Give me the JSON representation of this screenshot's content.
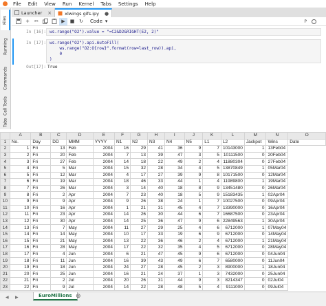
{
  "menubar": {
    "items": [
      "File",
      "Edit",
      "View",
      "Run",
      "Kernel",
      "Tabs",
      "Settings",
      "Help"
    ]
  },
  "sidebar": {
    "tabs": [
      "Files",
      "Running",
      "Commands",
      "Cell Tools",
      "Tabs"
    ]
  },
  "tabs": [
    {
      "label": "Launcher"
    },
    {
      "label": "xlwings gifs.ipy"
    }
  ],
  "toolbar": {
    "cell_type": "Code",
    "cell_type_arrow": "▾",
    "kernel_name": "P"
  },
  "cells": [
    {
      "prompt": "In [16]:",
      "code": "ws.range(\"O2\").value = \"=C2&D2&RIGHT(E2, 2)\""
    },
    {
      "prompt": "In [17]:",
      "code": "ws.range(\"O2\").api.AutoFill(\n    ws.range(\"O2:O{row}\".format(row=last_row)).api,\n    0\n)"
    },
    {
      "prompt": "Out[17]:",
      "output": "True"
    }
  ],
  "sheet": {
    "columns": [
      "",
      "A",
      "B",
      "C",
      "D",
      "E",
      "F",
      "G",
      "H",
      "I",
      "J",
      "K",
      "L",
      "M",
      "N",
      "O"
    ],
    "headers": [
      "No.",
      "Day",
      "DD",
      "MMM",
      "YYYY",
      "N1",
      "N2",
      "N3",
      "N4",
      "N5",
      "L1",
      "L2",
      "Jackpot",
      "Wins",
      "Date"
    ],
    "rows": [
      [
        "1",
        "Fri",
        "13",
        "Feb",
        "2004",
        "16",
        "29",
        "41",
        "36",
        "9",
        "7",
        "10143000",
        "1",
        "13Feb04"
      ],
      [
        "2",
        "Fri",
        "20",
        "Feb",
        "2004",
        "7",
        "13",
        "39",
        "47",
        "3",
        "5",
        "10111500",
        "0",
        "20Feb04"
      ],
      [
        "3",
        "Fri",
        "27",
        "Feb",
        "2004",
        "14",
        "18",
        "22",
        "49",
        "2",
        "4",
        "11880304",
        "0",
        "27Feb04"
      ],
      [
        "4",
        "Fri",
        "5",
        "Mar",
        "2004",
        "15",
        "32",
        "28",
        "34",
        "4",
        "5",
        "13870849",
        "1",
        "05Mar04"
      ],
      [
        "5",
        "Fri",
        "12",
        "Mar",
        "2004",
        "4",
        "17",
        "27",
        "39",
        "9",
        "8",
        "10171500",
        "0",
        "12Mar04"
      ],
      [
        "6",
        "Fri",
        "19",
        "Mar",
        "2004",
        "18",
        "46",
        "33",
        "44",
        "1",
        "4",
        "11989800",
        "1",
        "19Mar04"
      ],
      [
        "7",
        "Fri",
        "26",
        "Mar",
        "2004",
        "3",
        "14",
        "40",
        "18",
        "8",
        "9",
        "13451480",
        "0",
        "26Mar04"
      ],
      [
        "8",
        "Fri",
        "2",
        "Apr",
        "2004",
        "7",
        "23",
        "40",
        "18",
        "5",
        "9",
        "15183435",
        "1",
        "02Apr04"
      ],
      [
        "9",
        "Fri",
        "9",
        "Apr",
        "2004",
        "9",
        "26",
        "38",
        "24",
        "1",
        "7",
        "10027500",
        "0",
        "09Apr04"
      ],
      [
        "10",
        "Fri",
        "16",
        "Apr",
        "2004",
        "1",
        "21",
        "31",
        "45",
        "4",
        "7",
        "13390000",
        "0",
        "16Apr04"
      ],
      [
        "11",
        "Fri",
        "23",
        "Apr",
        "2004",
        "14",
        "26",
        "30",
        "44",
        "6",
        "7",
        "16687500",
        "0",
        "23Apr04"
      ],
      [
        "12",
        "Fri",
        "30",
        "Apr",
        "2004",
        "14",
        "25",
        "36",
        "47",
        "9",
        "6",
        "22849563",
        "1",
        "30Apr04"
      ],
      [
        "13",
        "Fri",
        "7",
        "May",
        "2004",
        "11",
        "27",
        "29",
        "25",
        "4",
        "6",
        "6712000",
        "1",
        "07May04"
      ],
      [
        "14",
        "Fri",
        "14",
        "May",
        "2004",
        "10",
        "17",
        "33",
        "19",
        "6",
        "9",
        "6712000",
        "0",
        "14May04"
      ],
      [
        "15",
        "Fri",
        "21",
        "May",
        "2004",
        "13",
        "22",
        "36",
        "46",
        "2",
        "4",
        "6712000",
        "1",
        "21May04"
      ],
      [
        "16",
        "Fri",
        "28",
        "May",
        "2004",
        "17",
        "22",
        "32",
        "35",
        "4",
        "5",
        "6712000",
        "0",
        "28May04"
      ],
      [
        "17",
        "Fri",
        "4",
        "Jun",
        "2004",
        "6",
        "21",
        "47",
        "45",
        "9",
        "6",
        "6712000",
        "0",
        "04Jun04"
      ],
      [
        "18",
        "Fri",
        "11",
        "Jun",
        "2004",
        "16",
        "39",
        "43",
        "49",
        "6",
        "7",
        "6580000",
        "0",
        "11Jun04"
      ],
      [
        "19",
        "Fri",
        "18",
        "Jun",
        "2004",
        "24",
        "27",
        "28",
        "45",
        "2",
        "3",
        "8900000",
        "1",
        "18Jun04"
      ],
      [
        "20",
        "Fri",
        "25",
        "Jun",
        "2004",
        "16",
        "21",
        "24",
        "37",
        "1",
        "3",
        "7432000",
        "0",
        "25Jun04"
      ],
      [
        "21",
        "Fri",
        "2",
        "Jul",
        "2004",
        "20",
        "26",
        "31",
        "44",
        "9",
        "3",
        "8214347",
        "0",
        "02Jul04"
      ],
      [
        "22",
        "Fri",
        "9",
        "Jul",
        "2004",
        "14",
        "22",
        "28",
        "48",
        "5",
        "4",
        "9111000",
        "0",
        "09Jul04"
      ]
    ]
  },
  "sheet_tabs": {
    "active": "EuroMillions",
    "add": "⊕"
  }
}
